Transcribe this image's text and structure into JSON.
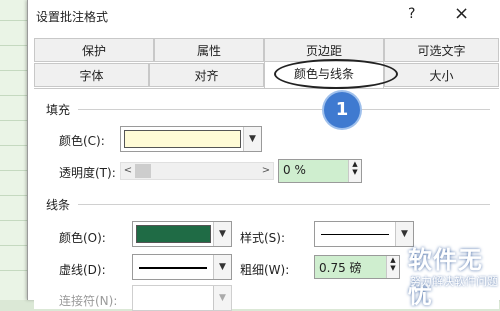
{
  "dialog": {
    "title": "设置批注格式",
    "help": "?",
    "close": "×"
  },
  "tabs": {
    "row1": [
      "保护",
      "属性",
      "页边距",
      "可选文字"
    ],
    "row2": [
      "字体",
      "对齐",
      "颜色与线条",
      "大小"
    ],
    "active": "颜色与线条"
  },
  "fill": {
    "section": "填充",
    "color_label": "颜色(C):",
    "color_value": "#fffbd6",
    "transparency_label": "透明度(T):",
    "transparency_value": "0 %",
    "transparency_fraction": 0
  },
  "line": {
    "section": "线条",
    "color_label": "颜色(O):",
    "color_value": "#1f6b45",
    "style_label": "样式(S):",
    "dash_label": "虚线(D):",
    "weight_label": "粗细(W):",
    "weight_value": "0.75 磅",
    "connector_label": "连接符(N):"
  },
  "annotation": {
    "step": "1"
  },
  "watermark": {
    "title": "软件无忧",
    "subtitle": "努力解决软件问题"
  }
}
